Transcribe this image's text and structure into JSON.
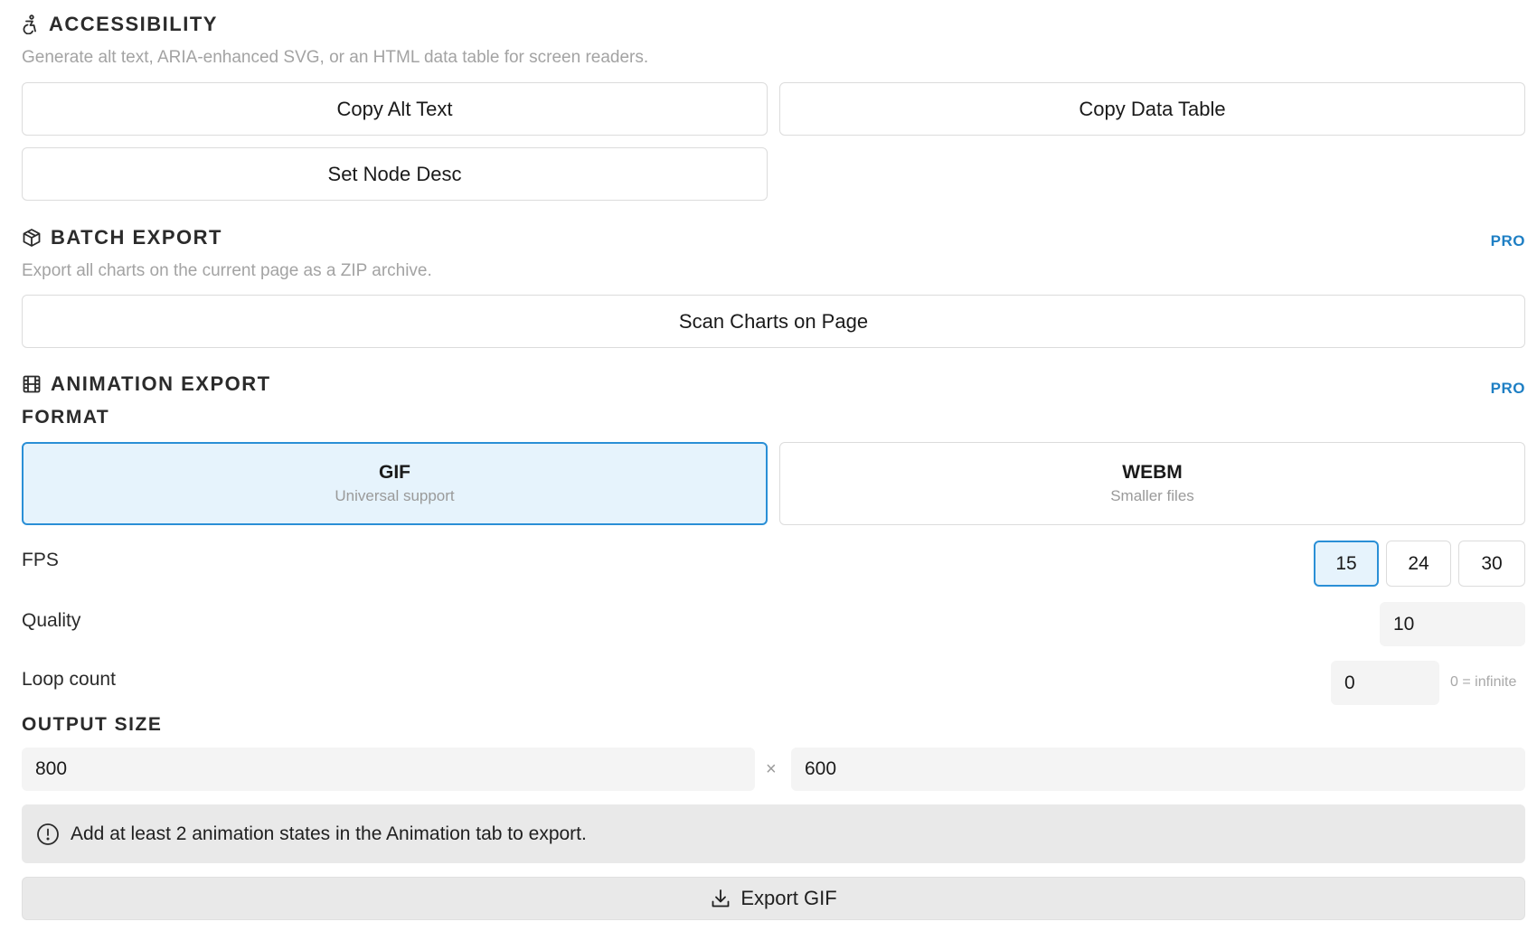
{
  "accessibility": {
    "title": "ACCESSIBILITY",
    "description": "Generate alt text, ARIA-enhanced SVG, or an HTML data table for screen readers.",
    "buttons": {
      "copy_alt_text": "Copy Alt Text",
      "copy_data_table": "Copy Data Table",
      "set_node_desc": "Set Node Desc"
    }
  },
  "batch_export": {
    "title": "BATCH EXPORT",
    "badge": "PRO",
    "description": "Export all charts on the current page as a ZIP archive.",
    "scan_button": "Scan Charts on Page"
  },
  "animation_export": {
    "title": "ANIMATION EXPORT",
    "badge": "PRO",
    "format_label": "FORMAT",
    "formats": [
      {
        "name": "GIF",
        "subtitle": "Universal support",
        "selected": true
      },
      {
        "name": "WEBM",
        "subtitle": "Smaller files",
        "selected": false
      }
    ],
    "fps_label": "FPS",
    "fps_options": [
      "15",
      "24",
      "30"
    ],
    "fps_selected": "15",
    "quality_label": "Quality",
    "quality_value": "10",
    "loop_label": "Loop count",
    "loop_value": "0",
    "loop_hint": "0 = infinite",
    "output_size_label": "OUTPUT SIZE",
    "width": "800",
    "times": "×",
    "height": "600",
    "notice": "Add at least 2 animation states in the Animation tab to export.",
    "export_button": "Export GIF"
  },
  "colors": {
    "accent": "#2a8fd6",
    "pro": "#1e7fc4",
    "selected_bg": "#e6f3fc",
    "muted": "#a3a3a3"
  },
  "icons": {
    "accessibility": "wheelchair-icon",
    "batch": "package-icon",
    "animation": "film-icon",
    "notice": "info-circle-icon",
    "export": "download-icon"
  }
}
